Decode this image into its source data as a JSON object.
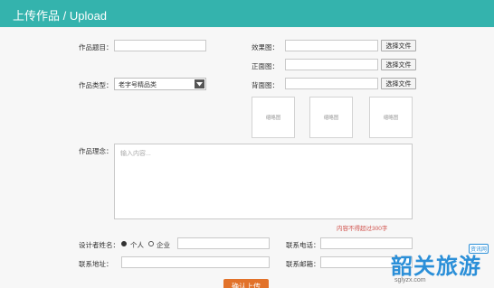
{
  "header": {
    "title": "上传作品 / Upload"
  },
  "form": {
    "title_label": "作品题目：",
    "type_label": "作品类型：",
    "type_selected": "老字号精品类",
    "effect_label": "效果图：",
    "front_label": "正面图：",
    "back_label": "背面图：",
    "choose_file": "选择文件",
    "thumb_text": "缩略图",
    "concept_label": "作品理念：",
    "concept_placeholder": "输入内容...",
    "limit_text": "内容不得超过300字",
    "designer_label": "设计者姓名：",
    "radio_person": "个人",
    "radio_company": "企业",
    "phone_label": "联系电话：",
    "address_label": "联系地址：",
    "email_label": "联系邮箱：",
    "submit_label": "确认上传"
  },
  "watermark": {
    "brand": "韶关旅游",
    "badge": "资讯网",
    "url": "sglyzx.com"
  },
  "colors": {
    "header": "#34b3ad",
    "submit": "#e2722a",
    "limit": "#d0504a",
    "watermark": "#2b8fd8"
  }
}
